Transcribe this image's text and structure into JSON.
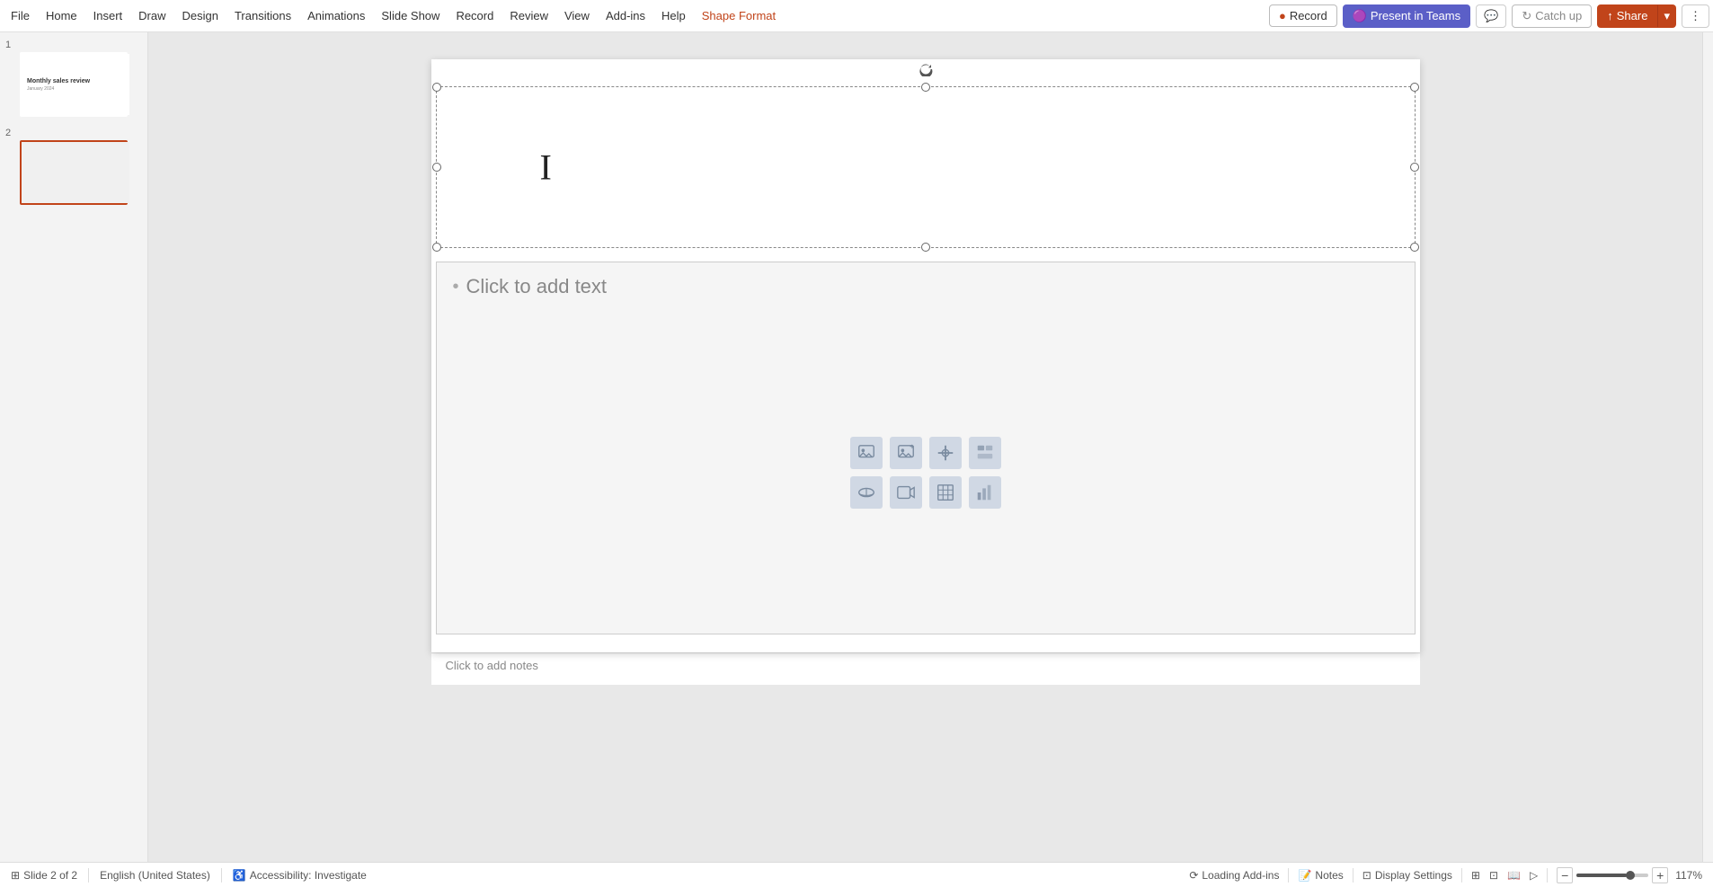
{
  "menubar": {
    "items": [
      {
        "label": "File",
        "active": false
      },
      {
        "label": "Home",
        "active": false
      },
      {
        "label": "Insert",
        "active": false
      },
      {
        "label": "Draw",
        "active": false
      },
      {
        "label": "Design",
        "active": false
      },
      {
        "label": "Transitions",
        "active": false
      },
      {
        "label": "Animations",
        "active": false
      },
      {
        "label": "Slide Show",
        "active": false
      },
      {
        "label": "Record",
        "active": false
      },
      {
        "label": "Review",
        "active": false
      },
      {
        "label": "View",
        "active": false
      },
      {
        "label": "Add-ins",
        "active": false
      },
      {
        "label": "Help",
        "active": false
      },
      {
        "label": "Shape Format",
        "active": true
      }
    ],
    "record_label": "Record",
    "present_label": "Present in Teams",
    "catchup_label": "Catch up",
    "share_label": "Share",
    "comment_icon": "💬"
  },
  "slides": [
    {
      "number": "1",
      "title": "Monthly sales review",
      "subtitle": "January 2024",
      "active": false
    },
    {
      "number": "2",
      "title": "",
      "subtitle": "",
      "active": true
    }
  ],
  "canvas": {
    "title_placeholder": "",
    "content_placeholder": "Click to add text",
    "add_notes": "Click to add notes"
  },
  "content_icons": [
    {
      "icon": "🖼",
      "label": "Insert Picture"
    },
    {
      "icon": "🖼",
      "label": "Online Pictures"
    },
    {
      "icon": "📌",
      "label": "Insert Icons"
    },
    {
      "icon": "📄",
      "label": "Insert File"
    },
    {
      "icon": "👤",
      "label": "Insert Person"
    },
    {
      "icon": "📹",
      "label": "Insert Video"
    },
    {
      "icon": "⊞",
      "label": "Insert Table"
    },
    {
      "icon": "📊",
      "label": "Insert Chart"
    }
  ],
  "statusbar": {
    "slide_info": "Slide 2 of 2",
    "language": "English (United States)",
    "accessibility": "Accessibility: Investigate",
    "loading": "Loading Add-ins",
    "notes": "Notes",
    "display_settings": "Display Settings",
    "zoom": "117%"
  }
}
